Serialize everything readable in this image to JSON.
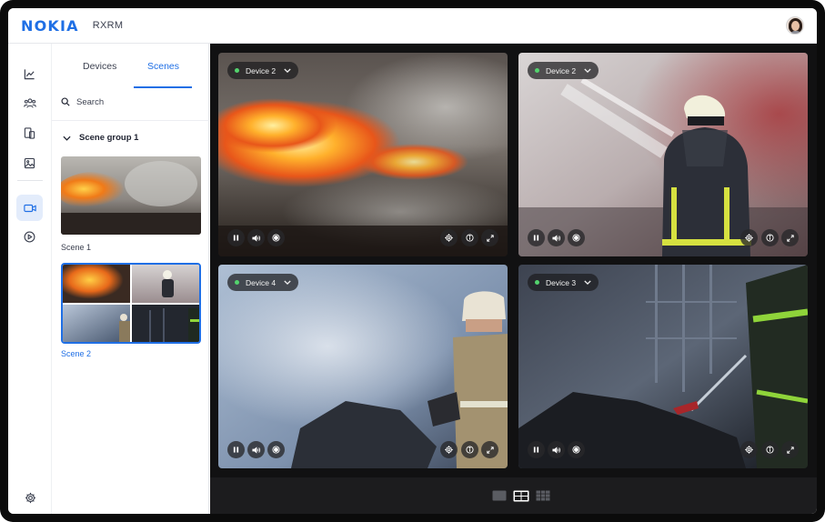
{
  "header": {
    "logo_text": "NOKIA",
    "app_name": "RXRM"
  },
  "rail": {
    "items": [
      "chart-icon",
      "people-icon",
      "devices-icon",
      "image-icon",
      "video-camera-icon",
      "play-icon"
    ],
    "active": "video-camera-icon",
    "settings": "gear-icon"
  },
  "panel": {
    "tabs": [
      {
        "label": "Devices",
        "active": false
      },
      {
        "label": "Scenes",
        "active": true
      }
    ],
    "search_label": "Search",
    "group_label": "Scene group 1",
    "scenes": [
      {
        "name": "Scene 1",
        "selected": false
      },
      {
        "name": "Scene 2",
        "selected": true
      }
    ]
  },
  "tiles": [
    {
      "device": "Device 2",
      "status": "online",
      "controls_left": [
        "pause-icon",
        "volume-icon",
        "record-icon"
      ],
      "controls_right": [
        "settings-icon",
        "info-icon",
        "expand-icon"
      ]
    },
    {
      "device": "Device 2",
      "status": "online",
      "controls_left": [
        "pause-icon",
        "volume-icon",
        "record-icon"
      ],
      "controls_right": [
        "settings-icon",
        "info-icon",
        "expand-icon"
      ]
    },
    {
      "device": "Device 4",
      "status": "online",
      "controls_left": [
        "pause-icon",
        "volume-icon",
        "record-icon"
      ],
      "controls_right": [
        "settings-icon",
        "info-icon",
        "expand-icon"
      ]
    },
    {
      "device": "Device 3",
      "status": "online",
      "controls_left": [
        "pause-icon",
        "volume-icon",
        "record-icon"
      ],
      "controls_right": [
        "settings-icon",
        "info-icon",
        "expand-icon"
      ]
    }
  ],
  "layouts": {
    "options": [
      "single-layout-icon",
      "grid-2x2-layout-icon",
      "grid-3x3-layout-icon"
    ],
    "selected": "grid-2x2-layout-icon"
  },
  "colors": {
    "accent": "#1f6fe5",
    "status_online": "#53d36d",
    "stage_bg": "#111112"
  }
}
